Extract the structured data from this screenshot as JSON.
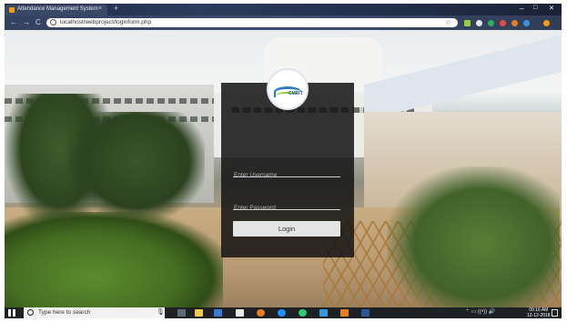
{
  "browser": {
    "tab_title": "Attendance Management System",
    "tab_close": "×",
    "new_tab": "+",
    "url": "localhost/webproject/loginform.php",
    "back": "←",
    "forward": "→",
    "reload": "C",
    "bookmark_star": "☆",
    "window_minimize": "–",
    "window_maximize": "□",
    "window_close": "✕"
  },
  "login": {
    "username_placeholder": "Enter Username",
    "password_placeholder": "Enter Password",
    "login_label": "Login",
    "logo_text": "CMRIT"
  },
  "taskbar": {
    "search_placeholder": "Type here to search",
    "time": "09:16 AM",
    "date": "12-12-2018"
  },
  "colors": {
    "panel_bg": "#141414",
    "button_bg": "#e4e4e4",
    "logo_blue": "#2e7dbf",
    "logo_green": "#9acb3c"
  }
}
